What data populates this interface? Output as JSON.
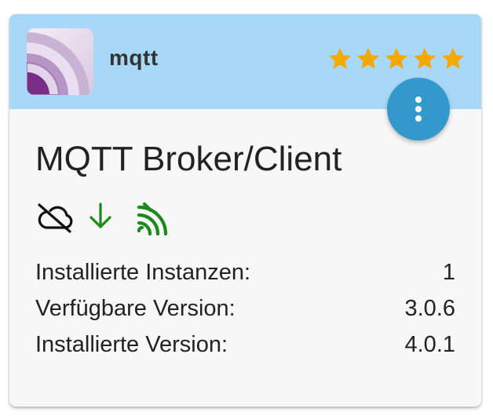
{
  "adapter": {
    "name": "mqtt",
    "title": "MQTT Broker/Client",
    "rating_stars": 5,
    "rating_max": 5
  },
  "colors": {
    "header_bg": "#a8d8f8",
    "star": "#f5a800",
    "fab": "#3399cc",
    "status_green": "#1a8a1a"
  },
  "icons": [
    "cloud-off-icon",
    "arrow-down-icon",
    "signal-icon"
  ],
  "info": [
    {
      "label": "Installierte Instanzen:",
      "value": "1"
    },
    {
      "label": "Verfügbare Version:",
      "value": "3.0.6"
    },
    {
      "label": "Installierte Version:",
      "value": "4.0.1"
    }
  ]
}
